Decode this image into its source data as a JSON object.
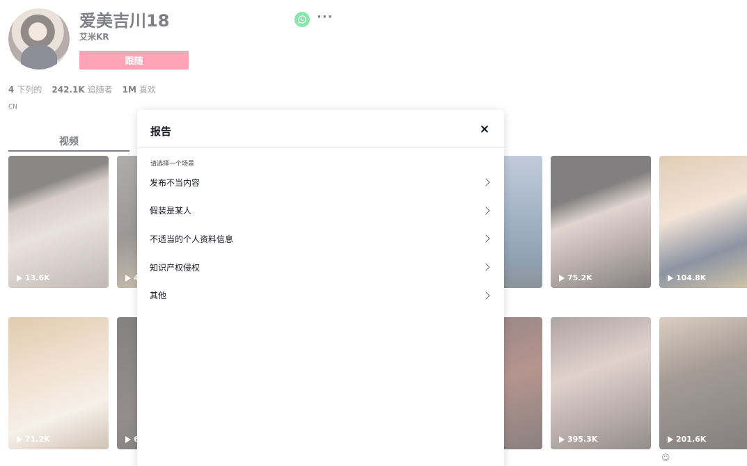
{
  "profile": {
    "username": "爱美吉川18",
    "nickname": "艾米KR",
    "follow_label": "跟随",
    "more_label": "···",
    "stats": {
      "following_count": "4",
      "following_label": "下列的",
      "followers_count": "242.1K",
      "followers_label": "追随者",
      "likes_count": "1M",
      "likes_label": "喜欢"
    },
    "region": "CN"
  },
  "tabs": {
    "videos_label": "视频"
  },
  "videos": [
    {
      "views": "13.6K"
    },
    {
      "views": "4"
    },
    {
      "views": ""
    },
    {
      "views": "75.2K"
    },
    {
      "views": "104.8K"
    },
    {
      "views": "71.2K"
    },
    {
      "views": "6"
    },
    {
      "views": ""
    },
    {
      "views": "395.3K"
    },
    {
      "views": "201.6K"
    }
  ],
  "report_modal": {
    "title": "报告",
    "subtitle": "请选择一个场景",
    "reasons": [
      {
        "label": "发布不当内容"
      },
      {
        "label": "假装是某人"
      },
      {
        "label": "不适当的个人资料信息"
      },
      {
        "label": "知识产权侵权"
      },
      {
        "label": "其他"
      }
    ]
  },
  "colors": {
    "follow_button": "#fe2c55",
    "whatsapp": "#25d366",
    "text_primary": "#161823"
  },
  "icons": {
    "share": "whatsapp-icon",
    "close": "close-icon",
    "chevron": "chevron-right-icon",
    "play": "play-icon"
  }
}
